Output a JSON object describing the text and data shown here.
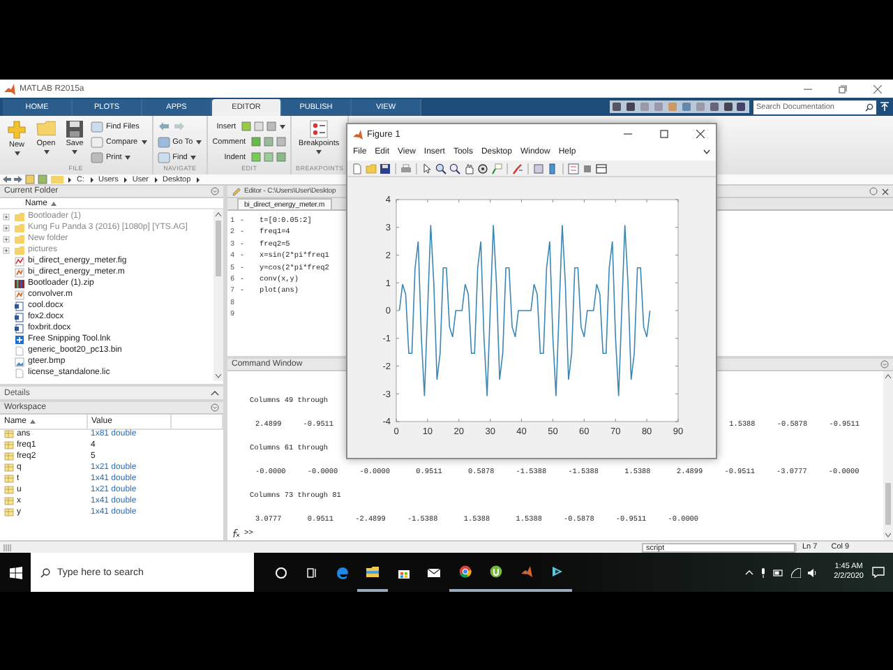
{
  "window": {
    "title": "MATLAB R2015a"
  },
  "ribbon_tabs": [
    {
      "label": "HOME",
      "selected": false
    },
    {
      "label": "PLOTS",
      "selected": false
    },
    {
      "label": "APPS",
      "selected": false
    },
    {
      "label": "EDITOR",
      "selected": true
    },
    {
      "label": "PUBLISH",
      "selected": false
    },
    {
      "label": "VIEW",
      "selected": false
    }
  ],
  "search": {
    "placeholder": "Search Documentation"
  },
  "ribbon_groups": [
    {
      "label": "FILE",
      "buttons": [
        {
          "kind": "large",
          "label": "New",
          "menu": true
        },
        {
          "kind": "large",
          "label": "Open",
          "menu": true
        },
        {
          "kind": "large",
          "label": "Save",
          "menu": true
        },
        {
          "kind": "small",
          "label": "Find Files",
          "menu": false
        },
        {
          "kind": "small",
          "label": "Compare",
          "menu": true
        },
        {
          "kind": "small",
          "label": "Print",
          "menu": true
        }
      ]
    },
    {
      "label": "NAVIGATE",
      "buttons": [
        {
          "kind": "arrows",
          "menu": false
        },
        {
          "kind": "small",
          "label": "Go To",
          "menu": true
        },
        {
          "kind": "small",
          "label": "Find",
          "menu": true
        }
      ]
    },
    {
      "label": "EDIT",
      "buttons": [
        {
          "kind": "row",
          "label": "Insert",
          "menu": true
        },
        {
          "kind": "row",
          "label": "Comment",
          "menu": false
        },
        {
          "kind": "row",
          "label": "Indent",
          "menu": false
        }
      ]
    },
    {
      "label": "BREAKPOINTS",
      "buttons": [
        {
          "kind": "large",
          "label": "Breakpoints",
          "menu": true
        }
      ]
    }
  ],
  "address": [
    "C:",
    "Users",
    "User",
    "Desktop"
  ],
  "current_folder": {
    "title": "Current Folder",
    "column": "Name",
    "items": [
      {
        "kind": "folder",
        "name": "Bootloader (1)"
      },
      {
        "kind": "folder",
        "name": "Kung Fu Panda 3 (2016) [1080p] [YTS.AG]"
      },
      {
        "kind": "folder",
        "name": "New folder"
      },
      {
        "kind": "folder",
        "name": "pictures"
      },
      {
        "kind": "fig",
        "name": "bi_direct_energy_meter.fig"
      },
      {
        "kind": "m",
        "name": "bi_direct_energy_meter.m"
      },
      {
        "kind": "zip",
        "name": "Bootloader (1).zip"
      },
      {
        "kind": "m",
        "name": "convolver.m"
      },
      {
        "kind": "doc",
        "name": "cool.docx"
      },
      {
        "kind": "doc",
        "name": "fox2.docx"
      },
      {
        "kind": "doc",
        "name": "foxbrit.docx"
      },
      {
        "kind": "lnk",
        "name": "Free Snipping Tool.lnk"
      },
      {
        "kind": "file",
        "name": "generic_boot20_pc13.bin"
      },
      {
        "kind": "image",
        "name": "gteer.bmp"
      },
      {
        "kind": "file",
        "name": "license_standalone.lic"
      }
    ]
  },
  "details": {
    "title": "Details"
  },
  "workspace": {
    "title": "Workspace",
    "columns": [
      "Name",
      "Value"
    ],
    "rows": [
      {
        "name": "ans",
        "value": "1x81 double",
        "kind": "array"
      },
      {
        "name": "freq1",
        "value": "4",
        "kind": "scalar"
      },
      {
        "name": "freq2",
        "value": "5",
        "kind": "scalar"
      },
      {
        "name": "q",
        "value": "1x21 double",
        "kind": "array"
      },
      {
        "name": "t",
        "value": "1x41 double",
        "kind": "array"
      },
      {
        "name": "u",
        "value": "1x21 double",
        "kind": "array"
      },
      {
        "name": "x",
        "value": "1x41 double",
        "kind": "array"
      },
      {
        "name": "y",
        "value": "1x41 double",
        "kind": "array"
      }
    ]
  },
  "editor": {
    "title": "Editor - C:\\Users\\User\\Desktop",
    "tab": "bi_direct_energy_meter.m",
    "lines": [
      {
        "number": "1",
        "marker": "-",
        "code": "t=[0:0.05:2]"
      },
      {
        "number": "2",
        "marker": "-",
        "code": "freq1=4"
      },
      {
        "number": "3",
        "marker": "-",
        "code": "freq2=5"
      },
      {
        "number": "4",
        "marker": "-",
        "code": "x=sin(2*pi*freq1"
      },
      {
        "number": "5",
        "marker": "-",
        "code": "y=cos(2*pi*freq2"
      },
      {
        "number": "6",
        "marker": "-",
        "code": "conv(x,y)"
      },
      {
        "number": "7",
        "marker": "-",
        "code": "plot(ans)"
      },
      {
        "number": "8"
      },
      {
        "number": "9"
      }
    ]
  },
  "command_window": {
    "title": "Command Window",
    "lines": [
      {
        "kind": "header",
        "left": "Columns 49 through"
      },
      {
        "kind": "values",
        "left": "2.4899     -0.9511",
        "right": "1.5388     -0.5878     -0.9511"
      },
      {
        "kind": "header",
        "left": "Columns 61 through"
      },
      {
        "kind": "values",
        "left": "-0.0000     -0.0000     -0.0000      0.9511      0.5878     -1.5388     -1.5388      1.5388      2.4899     -0.9511     -3.0777     -0.0000"
      },
      {
        "kind": "header",
        "left": "Columns 73 through 81"
      },
      {
        "kind": "values",
        "left": "3.0777      0.9511     -2.4899     -1.5388      1.5388      1.5388     -0.5878     -0.9511     -0.0000"
      }
    ],
    "prompt": ">>"
  },
  "status_bar": {
    "mode": "script",
    "line": "Ln 7",
    "column": "Col 9"
  },
  "taskbar": {
    "search_placeholder": "Type here to search",
    "apps": [
      {
        "kind": "cortana",
        "running": false
      },
      {
        "kind": "taskview",
        "running": false
      },
      {
        "kind": "edge",
        "running": false
      },
      {
        "kind": "explorer",
        "running": true
      },
      {
        "kind": "store",
        "running": false
      },
      {
        "kind": "mail",
        "running": false
      },
      {
        "kind": "chrome",
        "running": true
      },
      {
        "kind": "torrent",
        "running": true
      },
      {
        "kind": "matlab",
        "running": true
      },
      {
        "kind": "app",
        "running": true
      }
    ],
    "time": "1:45 AM",
    "date": "2/2/2020"
  },
  "figure": {
    "title": "Figure 1",
    "menu": [
      "File",
      "Edit",
      "View",
      "Insert",
      "Tools",
      "Desktop",
      "Window",
      "Help"
    ],
    "chart_data": {
      "type": "line",
      "x": [
        1,
        2,
        3,
        4,
        5,
        6,
        7,
        8,
        9,
        10,
        11,
        12,
        13,
        14,
        15,
        16,
        17,
        18,
        19,
        20,
        21,
        22,
        23,
        24,
        25,
        26,
        27,
        28,
        29,
        30,
        31,
        32,
        33,
        34,
        35,
        36,
        37,
        38,
        39,
        40,
        41,
        42,
        43,
        44,
        45,
        46,
        47,
        48,
        49,
        50,
        51,
        52,
        53,
        54,
        55,
        56,
        57,
        58,
        59,
        60,
        61,
        62,
        63,
        64,
        65,
        66,
        67,
        68,
        69,
        70,
        71,
        72,
        73,
        74,
        75,
        76,
        77,
        78,
        79,
        80,
        81
      ],
      "series": [
        {
          "color": "#3a86b4",
          "values": [
            0,
            0.95,
            0.59,
            -1.54,
            -1.54,
            1.54,
            2.49,
            -0.95,
            -3.08,
            0,
            3.08,
            0.95,
            -2.49,
            -1.54,
            1.54,
            1.54,
            -0.59,
            -0.95,
            0,
            0,
            0,
            0.95,
            0.59,
            -1.54,
            -1.54,
            1.54,
            2.49,
            -0.95,
            -3.08,
            0,
            3.08,
            0.95,
            -2.49,
            -1.54,
            1.54,
            1.54,
            -0.59,
            -0.95,
            0,
            0,
            0,
            0,
            0,
            0.95,
            0.59,
            -1.54,
            -1.54,
            1.54,
            2.49,
            -0.95,
            -3.08,
            0,
            3.08,
            0.95,
            -2.49,
            -1.54,
            1.54,
            1.54,
            -0.59,
            -0.95,
            0,
            0,
            0,
            0.95,
            0.59,
            -1.54,
            -1.54,
            1.54,
            2.49,
            -0.95,
            -3.08,
            0,
            3.08,
            0.95,
            -2.49,
            -1.54,
            1.54,
            1.54,
            -0.59,
            -0.95,
            0
          ]
        }
      ],
      "xlim": [
        0,
        90
      ],
      "ylim": [
        -4,
        4
      ],
      "xticks": [
        0,
        10,
        20,
        30,
        40,
        50,
        60,
        70,
        80,
        90
      ],
      "yticks": [
        -4,
        -3,
        -2,
        -1,
        0,
        1,
        2,
        3,
        4
      ]
    }
  }
}
